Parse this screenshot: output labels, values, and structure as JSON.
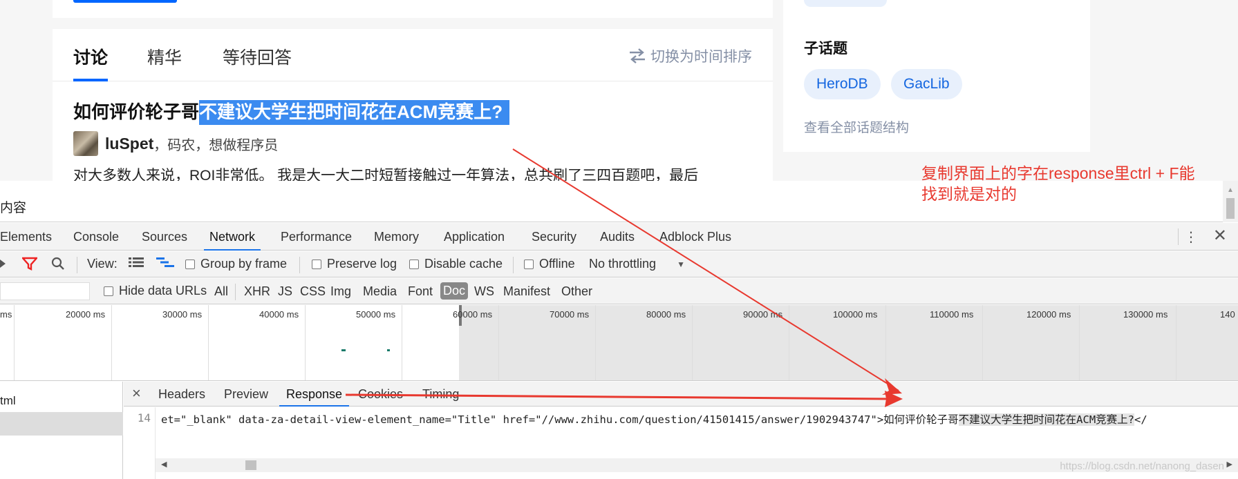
{
  "zhihu": {
    "tabs": [
      {
        "label": "讨论",
        "active": true
      },
      {
        "label": "精华",
        "active": false
      },
      {
        "label": "等待回答",
        "active": false
      }
    ],
    "sort_label": "切换为时间排序",
    "question_title_plain": "如何评价轮子哥",
    "question_title_highlight": "不建议大学生把时间花在ACM竞赛上?",
    "author_name": "luSpet",
    "author_desc": "，码农，想做程序员",
    "excerpt": "对大多数人来说，ROI非常低。 我是大一大二时短暂接触过一年算法，总共刷了三四百题吧，最后",
    "side": {
      "title": "子话题",
      "tags": [
        "HeroDB",
        "GacLib"
      ],
      "link": "查看全部话题结构"
    }
  },
  "devtools": {
    "header_title": "内容",
    "panel_tabs": [
      "Elements",
      "Console",
      "Sources",
      "Network",
      "Performance",
      "Memory",
      "Application",
      "Security",
      "Audits",
      "Adblock Plus"
    ],
    "active_panel": "Network",
    "toolbar": {
      "view_label": "View:",
      "group_by_frame": "Group by frame",
      "preserve_log": "Preserve log",
      "disable_cache": "Disable cache",
      "offline": "Offline",
      "throttling": "No throttling"
    },
    "filters": {
      "hide_data_urls": "Hide data URLs",
      "types": [
        "All",
        "XHR",
        "JS",
        "CSS",
        "Img",
        "Media",
        "Font",
        "Doc",
        "WS",
        "Manifest",
        "Other"
      ],
      "active_type": "Doc"
    },
    "timeline_ticks": [
      "ms",
      "20000 ms",
      "30000 ms",
      "40000 ms",
      "50000 ms",
      "60000 ms",
      "70000 ms",
      "80000 ms",
      "90000 ms",
      "100000 ms",
      "110000 ms",
      "120000 ms",
      "130000 ms",
      "140"
    ],
    "request_list": [
      "tml",
      ""
    ],
    "detail_tabs": [
      "Headers",
      "Preview",
      "Response",
      "Cookies",
      "Timing"
    ],
    "active_detail": "Response",
    "response": {
      "line_number": "14",
      "code_prefix": "et=\"_blank\" data-za-detail-view-element_name=\"Title\" href=\"//www.zhihu.com/question/41501415/answer/1902943747\">如何评价轮子哥",
      "code_selected": "不建议大学生把时间花在ACM竞赛上?",
      "code_suffix": "</"
    },
    "watermark": "https://blog.csdn.net/nanong_dasen"
  },
  "annotation": {
    "line1": "复制界面上的字在response里ctrl + F能",
    "line2": "找到就是对的",
    "color": "#e8392f"
  }
}
